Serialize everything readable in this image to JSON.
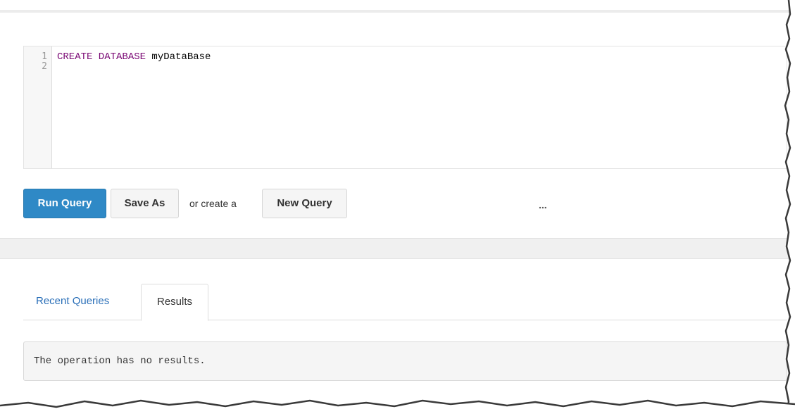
{
  "editor": {
    "line_numbers": [
      "1",
      "2"
    ],
    "lines": [
      {
        "keyword": "CREATE DATABASE",
        "rest": " myDataBase"
      },
      {
        "keyword": "",
        "rest": ""
      }
    ]
  },
  "toolbar": {
    "run_label": "Run Query",
    "save_as_label": "Save As",
    "or_create_text": "or create a",
    "new_query_label": "New Query",
    "more_label": "..."
  },
  "tabs": [
    {
      "label": "Recent Queries",
      "active": false
    },
    {
      "label": "Results",
      "active": true
    }
  ],
  "results": {
    "message": "The operation has no results."
  },
  "colors": {
    "primary_button": "#2f89c6",
    "keyword": "#7a0874",
    "link": "#2a6fb8"
  }
}
